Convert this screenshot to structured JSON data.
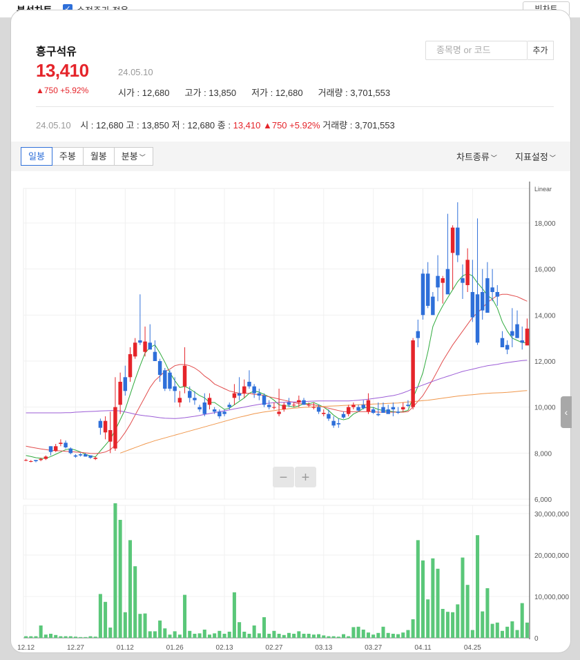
{
  "topbar": {
    "title": "분석차트",
    "adjusted_label": "수정주가 적용",
    "adjusted_checked": true,
    "big_chart_label": "빅차트"
  },
  "stock": {
    "name": "흥구석유",
    "price": "13,410",
    "date": "24.05.10",
    "change": "▲750 +5.92%",
    "open": "시가 : 12,680",
    "high": "고가 : 13,850",
    "low": "저가 : 12,680",
    "volume": "거래량 : 3,701,553"
  },
  "search": {
    "placeholder": "종목명 or 코드",
    "add_label": "추가"
  },
  "summary": {
    "date": "24.05.10",
    "open": "시 : 12,680",
    "high": "고 : 13,850",
    "low": "저 : 12,680",
    "close_label": "종 : ",
    "close": "13,410",
    "change": "▲750 +5.92%",
    "volume": "거래량 : 3,701,553"
  },
  "toolbar": {
    "tabs": [
      "일봉",
      "주봉",
      "월봉",
      "분봉"
    ],
    "active_tab": "일봉",
    "chart_type_label": "차트종류",
    "indicator_label": "지표설정"
  },
  "chart_data": {
    "type": "candlestick",
    "scale": "Linear",
    "price_axis": {
      "ticks": [
        6000,
        8000,
        10000,
        12000,
        14000,
        16000,
        18000
      ],
      "ylim": [
        6000,
        19500
      ]
    },
    "volume_axis": {
      "ticks": [
        0,
        10000000,
        20000000,
        30000000
      ],
      "tick_labels": [
        "0",
        "10,000,000",
        "20,000,000",
        "30,000,000"
      ],
      "ylim": [
        0,
        32000000
      ]
    },
    "x_tick_labels": [
      {
        "index": 0,
        "label": "12.12"
      },
      {
        "index": 10,
        "label": "12.27"
      },
      {
        "index": 20,
        "label": "01.12"
      },
      {
        "index": 30,
        "label": "01.26"
      },
      {
        "index": 40,
        "label": "02.13"
      },
      {
        "index": 50,
        "label": "02.27"
      },
      {
        "index": 60,
        "label": "03.13"
      },
      {
        "index": 70,
        "label": "03.27"
      },
      {
        "index": 80,
        "label": "04.11"
      },
      {
        "index": 90,
        "label": "04.25"
      }
    ],
    "candles": [
      [
        7700,
        7750,
        7650,
        7700
      ],
      [
        7650,
        7700,
        7600,
        7650
      ],
      [
        7700,
        7700,
        7600,
        7650
      ],
      [
        7700,
        7800,
        7650,
        7750
      ],
      [
        7750,
        7900,
        7700,
        7850
      ],
      [
        8300,
        8300,
        7900,
        8050
      ],
      [
        8100,
        8400,
        8050,
        8300
      ],
      [
        8400,
        8600,
        8300,
        8450
      ],
      [
        8450,
        8550,
        8200,
        8250
      ],
      [
        8200,
        8250,
        7950,
        8000
      ],
      [
        7900,
        7950,
        7800,
        7850
      ],
      [
        7950,
        8000,
        7850,
        7900
      ],
      [
        7950,
        8000,
        7850,
        7850
      ],
      [
        7900,
        7900,
        7750,
        7800
      ],
      [
        7750,
        7850,
        7700,
        7800
      ],
      [
        9400,
        9500,
        8800,
        9100
      ],
      [
        8900,
        9600,
        8600,
        9400
      ],
      [
        8500,
        9800,
        8000,
        9000
      ],
      [
        8200,
        11300,
        8100,
        10000
      ],
      [
        10100,
        11500,
        9700,
        11100
      ],
      [
        11300,
        11800,
        10500,
        10700
      ],
      [
        11300,
        12600,
        11100,
        12300
      ],
      [
        12200,
        13000,
        12100,
        12800
      ],
      [
        12900,
        14900,
        12700,
        12800
      ],
      [
        12400,
        13500,
        12200,
        12850
      ],
      [
        12800,
        13600,
        12600,
        12500
      ],
      [
        12400,
        12900,
        12200,
        12000
      ],
      [
        12000,
        12100,
        11100,
        11400
      ],
      [
        11600,
        11700,
        10700,
        10800
      ],
      [
        11500,
        11600,
        10700,
        10800
      ],
      [
        10900,
        11300,
        10200,
        10700
      ],
      [
        10200,
        10700,
        10000,
        10400
      ],
      [
        10900,
        12600,
        10600,
        11800
      ],
      [
        10700,
        10900,
        10200,
        10400
      ],
      [
        10400,
        10700,
        10100,
        10300
      ],
      [
        10000,
        10100,
        9800,
        9900
      ],
      [
        10200,
        10600,
        9600,
        9700
      ],
      [
        10100,
        10600,
        9900,
        10400
      ],
      [
        9900,
        10000,
        9700,
        9800
      ],
      [
        9800,
        9900,
        9500,
        9600
      ],
      [
        9800,
        9900,
        9600,
        9700
      ],
      [
        10100,
        10200,
        9900,
        10000
      ],
      [
        10400,
        11000,
        10100,
        10600
      ],
      [
        10600,
        11300,
        10300,
        10500
      ],
      [
        10600,
        11200,
        10400,
        10900
      ],
      [
        11100,
        11600,
        10800,
        10900
      ],
      [
        10900,
        11000,
        10400,
        10600
      ],
      [
        10600,
        10800,
        10300,
        10500
      ],
      [
        10500,
        10600,
        10000,
        10100
      ],
      [
        10100,
        10300,
        9900,
        10000
      ],
      [
        10000,
        10200,
        9900,
        10000
      ],
      [
        9700,
        10800,
        9600,
        9800
      ],
      [
        9900,
        10200,
        9800,
        10100
      ],
      [
        10200,
        10400,
        10000,
        10100
      ],
      [
        10100,
        10200,
        10000,
        10100
      ],
      [
        10200,
        10500,
        10000,
        10300
      ],
      [
        10300,
        10400,
        10100,
        10100
      ],
      [
        10100,
        10200,
        10000,
        10100
      ],
      [
        10000,
        10200,
        9900,
        10000
      ],
      [
        10000,
        10100,
        9700,
        9800
      ],
      [
        9700,
        9900,
        9600,
        9750
      ],
      [
        9700,
        9900,
        9400,
        9500
      ],
      [
        9400,
        9600,
        9100,
        9200
      ],
      [
        9300,
        9500,
        9100,
        9250
      ],
      [
        9700,
        9800,
        9500,
        9550
      ],
      [
        9700,
        10100,
        9600,
        10000
      ],
      [
        10000,
        10200,
        9900,
        10100
      ],
      [
        10000,
        10100,
        9800,
        9850
      ],
      [
        10100,
        10300,
        9900,
        9950
      ],
      [
        9800,
        10600,
        9700,
        10300
      ],
      [
        9900,
        10000,
        9700,
        9750
      ],
      [
        9700,
        10200,
        9600,
        9650
      ],
      [
        10000,
        10200,
        9800,
        9750
      ],
      [
        9900,
        10100,
        9800,
        9700
      ],
      [
        10000,
        10200,
        9600,
        9900
      ],
      [
        9800,
        10000,
        9700,
        9750
      ],
      [
        9900,
        10200,
        9800,
        10000
      ],
      [
        10100,
        10300,
        10000,
        10050
      ],
      [
        10000,
        13000,
        9900,
        12900
      ],
      [
        13300,
        13800,
        12600,
        13000
      ],
      [
        15800,
        16000,
        13800,
        14000
      ],
      [
        15800,
        16300,
        14300,
        14400
      ],
      [
        14800,
        15000,
        14000,
        14000
      ],
      [
        15700,
        16600,
        14600,
        15200
      ],
      [
        15400,
        15700,
        14500,
        15600
      ],
      [
        16000,
        18400,
        15200,
        14900
      ],
      [
        16700,
        17900,
        15100,
        17800
      ],
      [
        17800,
        18900,
        16300,
        16600
      ],
      [
        15600,
        16200,
        14700,
        15400
      ],
      [
        15300,
        16900,
        15000,
        16400
      ],
      [
        15000,
        16400,
        13700,
        13900
      ],
      [
        14900,
        18200,
        12700,
        12800
      ],
      [
        15000,
        16000,
        13800,
        14200
      ],
      [
        15600,
        16300,
        14400,
        14100
      ],
      [
        15200,
        16000,
        14600,
        15000
      ],
      [
        15000,
        15300,
        14400,
        14800
      ],
      [
        13000,
        13300,
        12800,
        12600
      ],
      [
        12700,
        12900,
        12300,
        12500
      ],
      [
        13300,
        14300,
        12600,
        13100
      ],
      [
        13600,
        14200,
        13000,
        13000
      ],
      [
        12900,
        13500,
        12500,
        12800
      ],
      [
        12680,
        13850,
        12680,
        13410
      ]
    ],
    "volumes": [
      400000,
      400000,
      400000,
      3000000,
      800000,
      1000000,
      700000,
      400000,
      400000,
      400000,
      300000,
      200000,
      200000,
      400000,
      300000,
      10600000,
      8700000,
      2500000,
      32500000,
      28500000,
      6200000,
      23600000,
      17300000,
      5800000,
      5900000,
      1600000,
      1600000,
      4200000,
      2300000,
      800000,
      1600000,
      800000,
      10400000,
      1700000,
      1000000,
      1100000,
      2000000,
      800000,
      1100000,
      1700000,
      1000000,
      1500000,
      11000000,
      3800000,
      1500000,
      1000000,
      3000000,
      1100000,
      5000000,
      1000000,
      1700000,
      1000000,
      700000,
      1200000,
      1000000,
      1600000,
      1000000,
      1000000,
      800000,
      900000,
      600000,
      400000,
      400000,
      300000,
      900000,
      400000,
      2600000,
      2700000,
      2000000,
      1300000,
      800000,
      1200000,
      2700000,
      1200000,
      1000000,
      900000,
      1300000,
      1900000,
      4500000,
      23600000,
      18700000,
      9300000,
      19200000,
      16700000,
      7000000,
      6300000,
      6200000,
      8100000,
      19400000,
      12800000,
      1900000,
      24800000,
      6400000,
      12000000,
      3400000,
      3700000,
      1700000,
      2700000,
      4000000,
      1900000,
      8400000,
      3700000
    ],
    "moving_averages": [
      {
        "color": "#2eaa3c",
        "values": [
          7900,
          7850,
          7800,
          7780,
          7770,
          7850,
          7950,
          8050,
          8150,
          8190,
          8130,
          8050,
          7950,
          7880,
          7840,
          8100,
          8350,
          8600,
          9000,
          9450,
          9900,
          10550,
          11200,
          11800,
          12350,
          12600,
          12700,
          12350,
          11950,
          11500,
          11150,
          10850,
          10900,
          10800,
          10650,
          10500,
          10400,
          10200,
          10200,
          10050,
          9900,
          9950,
          10100,
          10250,
          10400,
          10600,
          10700,
          10650,
          10550,
          10450,
          10300,
          10100,
          10050,
          10050,
          10000,
          10050,
          10150,
          10150,
          10200,
          10100,
          10000,
          9850,
          9650,
          9500,
          9450,
          9500,
          9700,
          9800,
          9950,
          10000,
          9980,
          9900,
          9850,
          9830,
          9800,
          9780,
          9800,
          9860,
          10400,
          10900,
          11500,
          12400,
          13500,
          14000,
          14400,
          14750,
          15100,
          15450,
          15700,
          15800,
          15700,
          15400,
          15150,
          14850,
          14700,
          14300,
          13700,
          13300,
          13000,
          12900,
          12800,
          12800
        ]
      },
      {
        "color": "#e24c4c",
        "values": [
          8300,
          8260,
          8220,
          8180,
          8150,
          8120,
          8100,
          8100,
          8080,
          8070,
          8050,
          8030,
          8010,
          7990,
          7980,
          8000,
          8050,
          8150,
          8350,
          8600,
          8900,
          9250,
          9650,
          10050,
          10450,
          10850,
          11150,
          11350,
          11550,
          11650,
          11800,
          11850,
          11850,
          11800,
          11700,
          11550,
          11350,
          11200,
          11000,
          10900,
          10800,
          10700,
          10650,
          10600,
          10600,
          10600,
          10550,
          10550,
          10500,
          10450,
          10400,
          10350,
          10300,
          10250,
          10200,
          10150,
          10150,
          10100,
          10100,
          10050,
          10000,
          9950,
          9900,
          9850,
          9800,
          9800,
          9800,
          9800,
          9800,
          9800,
          9800,
          9780,
          9780,
          9780,
          9780,
          9780,
          9780,
          9800,
          10000,
          10250,
          10500,
          10850,
          11200,
          11600,
          12000,
          12350,
          12700,
          13000,
          13300,
          13600,
          13900,
          14100,
          14300,
          14550,
          14700,
          14850,
          14900,
          14900,
          14850,
          14800,
          14700,
          14600
        ]
      },
      {
        "color": "#9b5bd6",
        "values": [
          9750,
          9750,
          9750,
          9750,
          9750,
          9750,
          9750,
          9750,
          9760,
          9760,
          9780,
          9790,
          9800,
          9810,
          9820,
          9830,
          9840,
          9850,
          9850,
          9830,
          9790,
          9740,
          9690,
          9650,
          9620,
          9600,
          9570,
          9540,
          9520,
          9510,
          9500,
          9520,
          9540,
          9570,
          9600,
          9640,
          9680,
          9720,
          9760,
          9800,
          9840,
          9880,
          9920,
          9960,
          10000,
          10040,
          10080,
          10120,
          10150,
          10170,
          10190,
          10200,
          10210,
          10220,
          10220,
          10230,
          10240,
          10250,
          10260,
          10270,
          10270,
          10270,
          10270,
          10270,
          10270,
          10270,
          10280,
          10300,
          10320,
          10340,
          10370,
          10400,
          10430,
          10470,
          10500,
          10550,
          10620,
          10700,
          10800,
          10880,
          10960,
          11040,
          11120,
          11200,
          11270,
          11340,
          11410,
          11480,
          11550,
          11600,
          11650,
          11700,
          11750,
          11800,
          11830,
          11860,
          11900,
          11930,
          11960,
          11990,
          12020,
          12040
        ]
      },
      {
        "color": "#f0964a",
        "values": [
          null,
          null,
          null,
          null,
          null,
          null,
          null,
          null,
          null,
          null,
          null,
          null,
          null,
          null,
          null,
          null,
          null,
          null,
          null,
          8000,
          8080,
          8160,
          8240,
          8320,
          8400,
          8470,
          8540,
          8600,
          8660,
          8720,
          8780,
          8840,
          8900,
          8960,
          9020,
          9080,
          9140,
          9200,
          9260,
          9320,
          9380,
          9440,
          9500,
          9560,
          9610,
          9660,
          9710,
          9750,
          9790,
          9820,
          9850,
          9880,
          9910,
          9930,
          9950,
          9970,
          9990,
          10000,
          10010,
          10020,
          10030,
          10040,
          10050,
          10060,
          10070,
          10080,
          10090,
          10100,
          10110,
          10120,
          10130,
          10140,
          10150,
          10160,
          10170,
          10180,
          10200,
          10220,
          10240,
          10260,
          10280,
          10300,
          10330,
          10360,
          10390,
          10420,
          10450,
          10480,
          10500,
          10520,
          10540,
          10560,
          10580,
          10600,
          10610,
          10620,
          10630,
          10640,
          10660,
          10680,
          10700,
          10720
        ]
      }
    ],
    "up_color": "#e5242a",
    "down_color": "#2e6fd9",
    "volume_color": "#5ac779"
  }
}
